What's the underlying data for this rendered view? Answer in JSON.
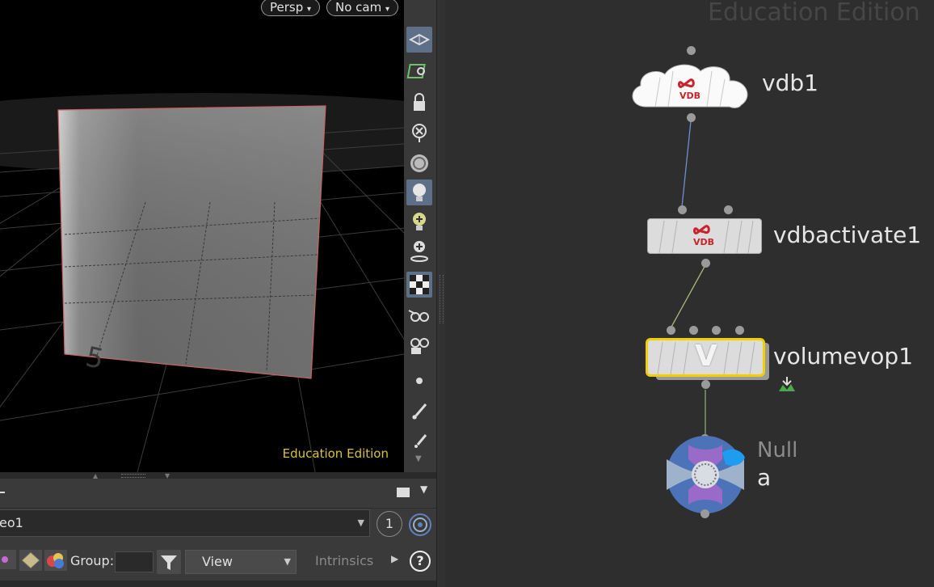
{
  "viewport": {
    "view_mode": "Persp",
    "camera": "No cam",
    "watermark": "Education Edition",
    "grid_label": "5"
  },
  "toolbar": {
    "items": [
      "display-options-icon",
      "snap-icon",
      "lock-camera-icon",
      "ghost-icon",
      "shading-sphere-icon",
      "headlight-icon",
      "light-add-icon",
      "spotlight-icon",
      "checker-icon",
      "visibility-glasses-icon",
      "render-glasses-icon",
      "point-icon",
      "brush-icon",
      "pin-icon"
    ]
  },
  "spreadsheet": {
    "node_path": "eo1",
    "badge": "1",
    "group_label": "Group:",
    "group_value": "",
    "view_label": "View",
    "intrinsics_label": "Intrinsics",
    "help": "?"
  },
  "network": {
    "watermark": "Education Edition",
    "nodes": [
      {
        "name": "vdb1",
        "icon_text": "VDB"
      },
      {
        "name": "vdbactivate1",
        "icon_text": "VDB"
      },
      {
        "name": "volumevop1",
        "icon_text": "V"
      },
      {
        "type_label": "Null",
        "name": "a"
      }
    ]
  },
  "colors": {
    "accent_selected": "#f2d000",
    "vdb_red": "#c8242a",
    "toolbar_active": "#5d7088",
    "watermark_yellow": "#d8c43a"
  }
}
